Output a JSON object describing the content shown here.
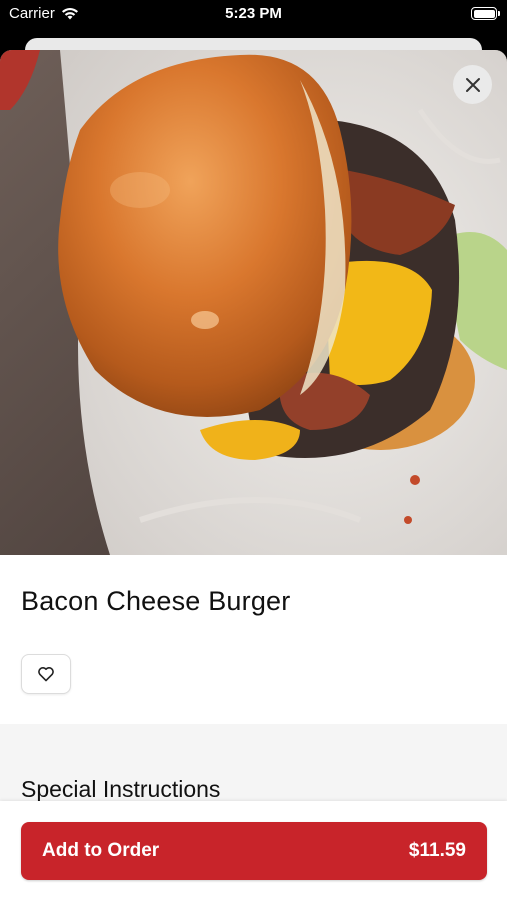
{
  "status_bar": {
    "carrier": "Carrier",
    "time": "5:23 PM"
  },
  "item": {
    "name": "Bacon Cheese Burger",
    "image_icon": "burger-photo"
  },
  "sections": {
    "special_instructions": "Special Instructions"
  },
  "order_button": {
    "label": "Add to Order",
    "price": "$11.59"
  },
  "colors": {
    "accent": "#c8242a",
    "section_bg": "#f5f5f5"
  }
}
